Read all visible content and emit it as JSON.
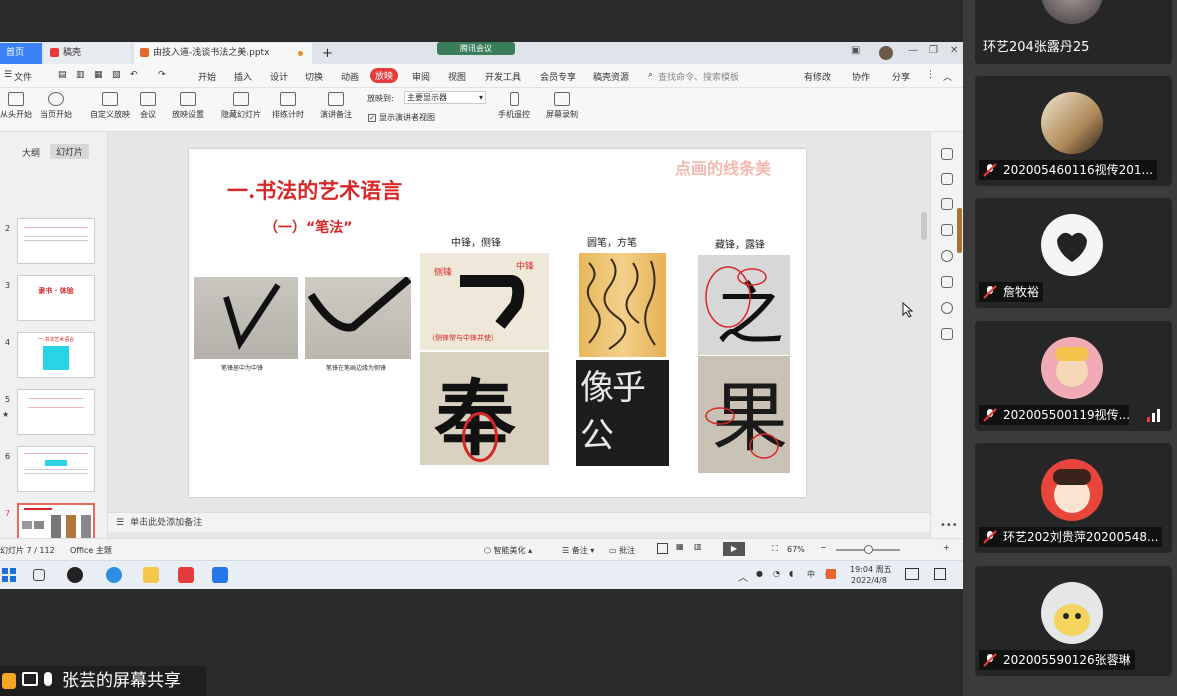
{
  "meeting": {
    "indicator_label": "腾讯会议"
  },
  "app": {
    "tabs": [
      {
        "label": "首页"
      },
      {
        "label": "稿壳"
      },
      {
        "label": "由技入道-浅谈书法之美.pptx"
      }
    ],
    "new_tab": "+",
    "menu": {
      "file": "文件",
      "items": [
        "开始",
        "插入",
        "设计",
        "切换",
        "动画",
        "放映",
        "审阅",
        "视图",
        "开发工具",
        "会员专享",
        "稿壳资源"
      ],
      "active_item": "放映",
      "search_placeholder": "查找命令、搜索模板",
      "right": [
        "有修改",
        "协作",
        "分享"
      ]
    },
    "toolbar": {
      "buttons": [
        "从头开始",
        "当页开始",
        "自定义放映",
        "会议",
        "放映设置",
        "隐藏幻灯片",
        "排练计时",
        "演讲备注",
        "手机遥控",
        "屏幕录制"
      ],
      "play_to_label": "放映到:",
      "play_to_value": "主要显示器",
      "presenter_view": "显示演讲者视图"
    },
    "left_panel": {
      "tabs": [
        "大纲",
        "幻灯片"
      ],
      "active_tab": "幻灯片",
      "thumbnails": [
        {
          "num": "2",
          "title": ""
        },
        {
          "num": "3",
          "title": "隶书 · 体验"
        },
        {
          "num": "4",
          "title": "一.书法艺术语言"
        },
        {
          "num": "5",
          "title": ""
        },
        {
          "num": "6",
          "title": ""
        },
        {
          "num": "7",
          "title": ""
        }
      ],
      "add_slide": "+"
    },
    "slide": {
      "title": "一.书法的艺术语言",
      "subtitle": "（一）“笔法”",
      "watermark": "点画的线条美",
      "col1_caption_a": "笔锋居中为中锋",
      "col1_caption_b": "笔锋在笔画边缘为侧锋",
      "col2_label": "中锋，侧锋",
      "col2_tag_left": "侧锋",
      "col2_tag_right": "中锋",
      "col2_note": "（侧锋常与中锋并使）",
      "col2_char": "奉",
      "col3_label": "圆笔，方笔",
      "col3_chars": "像乎公",
      "col4_label": "藏锋，露锋",
      "col4_char_top": "之",
      "col4_char_bottom": "果"
    },
    "notes_placeholder": "单击此处添加备注",
    "status": {
      "slide_info": "幻灯片 7 / 112",
      "theme": "Office 主题",
      "smart": "智能美化",
      "notes": "备注",
      "comments": "批注",
      "zoom": "67%"
    },
    "taskbar": {
      "time": "19:04 周五",
      "date": "2022/4/8"
    }
  },
  "share_banner": "张芸的屏幕共享",
  "participants": [
    {
      "name": "环艺204张露丹25",
      "muted": false
    },
    {
      "name": "202005460116视传201...",
      "muted": true
    },
    {
      "name": "詹牧裕",
      "muted": true
    },
    {
      "name": "202005500119视传...",
      "muted": true
    },
    {
      "name": "环艺202刘贵萍20200548...",
      "muted": true
    },
    {
      "name": "202005590126张蓉琳",
      "muted": true
    }
  ],
  "colors": {
    "accent_red": "#e63b3b",
    "slide_title_red": "#d62828",
    "tab_blue": "#3b82f6",
    "participant_bg": "#3b3b3b"
  }
}
